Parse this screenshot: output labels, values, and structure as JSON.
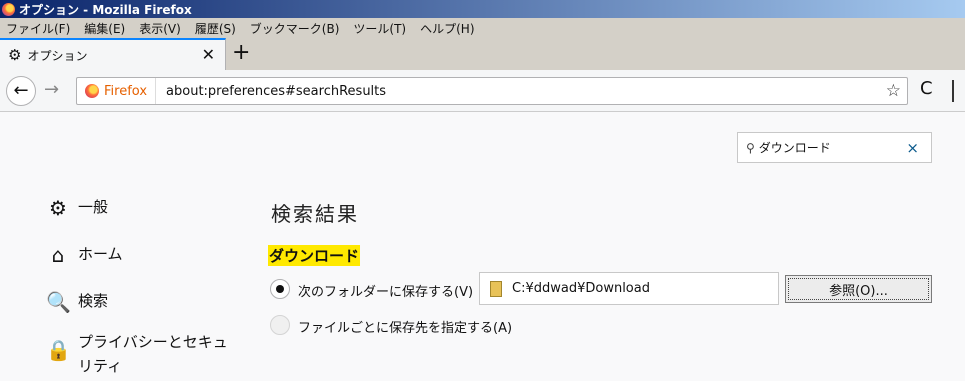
{
  "window": {
    "title": "オプション - Mozilla Firefox"
  },
  "menubar": {
    "items": [
      "ファイル(F)",
      "編集(E)",
      "表示(V)",
      "履歴(S)",
      "ブックマーク(B)",
      "ツール(T)",
      "ヘルプ(H)"
    ]
  },
  "tab": {
    "title": "オプション",
    "close": "✕",
    "new_tab": "+"
  },
  "navbar": {
    "back": "←",
    "forward": "→",
    "identity_label": "Firefox",
    "url": "about:preferences#searchResults",
    "bookmark_star": "☆",
    "reload": "C"
  },
  "search": {
    "glyph": "⚲",
    "value": "ダウンロード",
    "clear": "×"
  },
  "sidebar": {
    "items": [
      {
        "label": "一般",
        "icon": "gear-icon",
        "glyph": "⚙"
      },
      {
        "label": "ホーム",
        "icon": "home-icon",
        "glyph": "⌂"
      },
      {
        "label": "検索",
        "icon": "search-icon",
        "glyph": "🔍"
      },
      {
        "label": "プライバシーとセキュリティ",
        "icon": "lock-icon",
        "glyph": "🔒"
      }
    ]
  },
  "results": {
    "heading": "検索結果",
    "section": "ダウンロード",
    "option_save_to": "次のフォルダーに保存する(V)",
    "folder_path": "C:¥ddwad¥Download",
    "browse_button": "参照(O)...",
    "option_ask": "ファイルごとに保存先を指定する(A)",
    "selected_option": "save_to"
  }
}
